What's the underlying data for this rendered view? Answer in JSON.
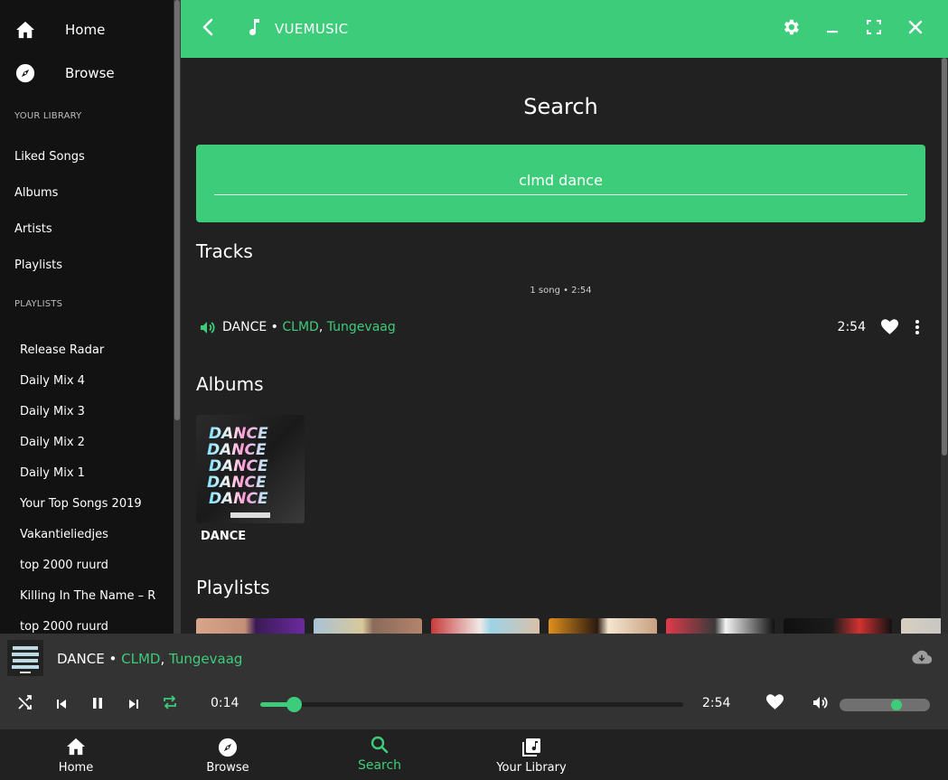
{
  "colors": {
    "accent": "#3dcc79",
    "sidebar_bg": "#121212",
    "main_bg": "#212121",
    "player_bg": "#333333"
  },
  "sidebar": {
    "nav": [
      {
        "label": "Home",
        "icon": "home-icon"
      },
      {
        "label": "Browse",
        "icon": "compass-icon"
      }
    ],
    "library_heading": "YOUR LIBRARY",
    "library": [
      "Liked Songs",
      "Albums",
      "Artists",
      "Playlists"
    ],
    "playlists_heading": "PLAYLISTS",
    "playlists": [
      "Release Radar",
      "Daily Mix 4",
      "Daily Mix 3",
      "Daily Mix 2",
      "Daily Mix 1",
      "Your Top Songs 2019",
      "Vakantieliedjes",
      "top 2000 ruurd",
      "Killing In The Name – R",
      "top 2000 ruurd"
    ]
  },
  "appbar": {
    "title": "VUEMUSIC",
    "icons": [
      "back-arrow-icon",
      "music-note-icon",
      "gear-icon",
      "minimize-icon",
      "fullscreen-icon",
      "close-icon"
    ]
  },
  "main": {
    "title": "Search",
    "search": {
      "value": "clmd dance",
      "placeholder": ""
    },
    "tracks_heading": "Tracks",
    "tracks_meta": "1 song • 2:54",
    "track": {
      "title": "DANCE",
      "separator": "•",
      "artist1": "CLMD",
      "artist2": "Tungevaag",
      "duration": "2:54"
    },
    "albums_heading": "Albums",
    "album": {
      "label": "DANCE",
      "art_text": "DANCE"
    },
    "playlists_heading": "Playlists"
  },
  "player": {
    "now_playing": {
      "title": "DANCE",
      "artist1": "CLMD",
      "artist2": "Tungevaag"
    },
    "time_current": "0:14",
    "time_total": "2:54",
    "progress_fraction": 0.08,
    "volume_fraction": 0.63
  },
  "bottom_nav": [
    {
      "label": "Home",
      "icon": "home-icon"
    },
    {
      "label": "Browse",
      "icon": "compass-icon"
    },
    {
      "label": "Search",
      "icon": "search-icon",
      "active": true
    },
    {
      "label": "Your Library",
      "icon": "library-icon"
    }
  ]
}
